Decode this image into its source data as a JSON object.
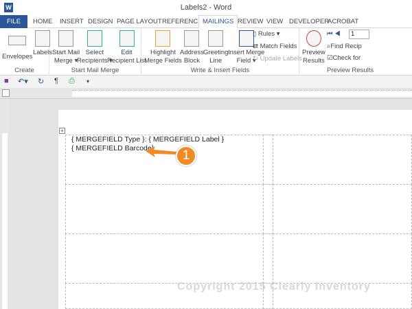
{
  "window": {
    "title": "Labels2 - Word",
    "app_icon": "W"
  },
  "tabs": [
    "FILE",
    "HOME",
    "INSERT",
    "DESIGN",
    "PAGE LAYOUT",
    "REFERENCES",
    "MAILINGS",
    "REVIEW",
    "VIEW",
    "DEVELOPER",
    "ACROBAT"
  ],
  "ribbon": {
    "create": {
      "label": "Create",
      "envelopes": "Envelopes",
      "labels": "Labels"
    },
    "start": {
      "label": "Start Mail Merge",
      "start_l1": "Start Mail",
      "start_l2": "Merge ▾",
      "select_l1": "Select",
      "select_l2": "Recipients ▾",
      "edit_l1": "Edit",
      "edit_l2": "Recipient List"
    },
    "write": {
      "label": "Write & Insert Fields",
      "highlight_l1": "Highlight",
      "highlight_l2": "Merge Fields",
      "address_l1": "Address",
      "address_l2": "Block",
      "greeting_l1": "Greeting",
      "greeting_l2": "Line",
      "insert_l1": "Insert Merge",
      "insert_l2": "Field ▾",
      "rules": "Rules ▾",
      "match": "Match Fields",
      "update": "Update Labels"
    },
    "preview": {
      "label": "Preview Results",
      "preview_l1": "Preview",
      "preview_l2": "Results",
      "record": "1",
      "find": "Find Recip",
      "check": "Check for"
    }
  },
  "document": {
    "line1": "{ MERGEFIELD Type }:  { MERGEFIELD Label }",
    "line2": "{ MERGEFIELD Barcode}",
    "callout": "1",
    "watermark": "Copyright 2015 Clearly Inventory"
  }
}
